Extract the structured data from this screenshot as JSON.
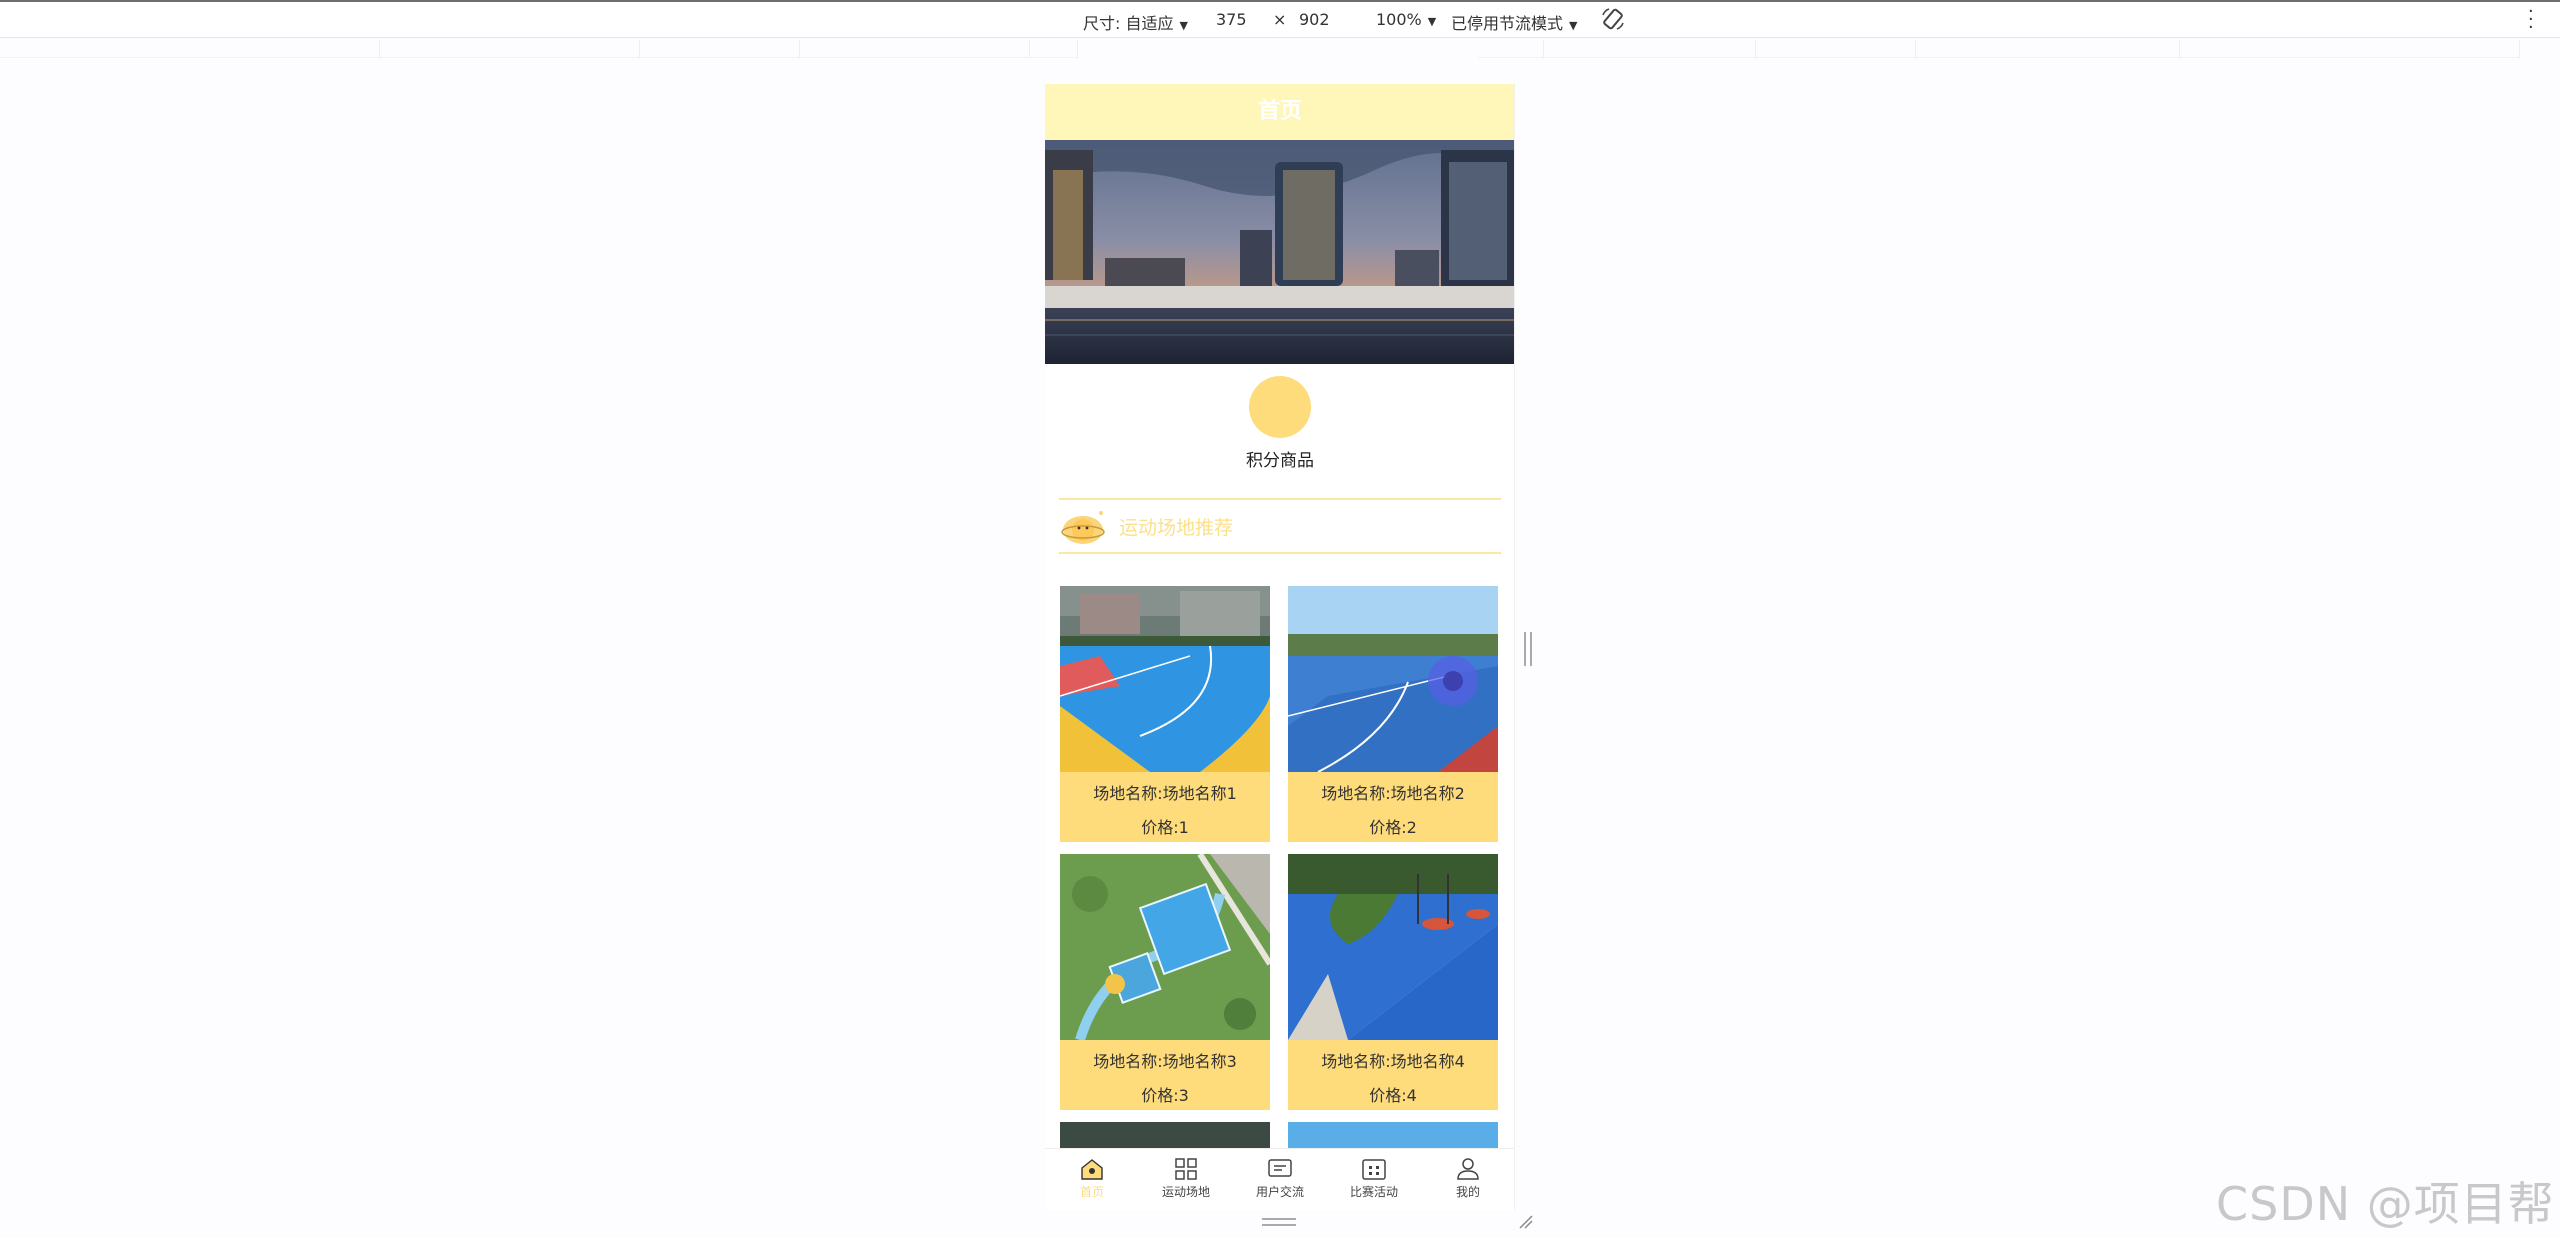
{
  "devtools": {
    "size_label": "尺寸: 自适应",
    "width": "375",
    "times": "×",
    "height": "902",
    "zoom": "100%",
    "throttle": "已停用节流模式"
  },
  "app": {
    "title": "首页",
    "category": {
      "label": "积分商品"
    },
    "section_title": "运动场地推荐",
    "venues": [
      {
        "name": "场地名称:场地名称1",
        "price": "价格:1"
      },
      {
        "name": "场地名称:场地名称2",
        "price": "价格:2"
      },
      {
        "name": "场地名称:场地名称3",
        "price": "价格:3"
      },
      {
        "name": "场地名称:场地名称4",
        "price": "价格:4"
      }
    ],
    "tabs": [
      {
        "label": "首页",
        "icon": "home-icon"
      },
      {
        "label": "运动场地",
        "icon": "grid-icon"
      },
      {
        "label": "用户交流",
        "icon": "message-icon"
      },
      {
        "label": "比赛活动",
        "icon": "calendar-icon"
      },
      {
        "label": "我的",
        "icon": "user-icon"
      }
    ]
  },
  "watermark": "CSDN @项目帮",
  "colors": {
    "accent": "#fedb7b",
    "title_bar": "#fff7b9",
    "section_text": "#fde08a"
  }
}
